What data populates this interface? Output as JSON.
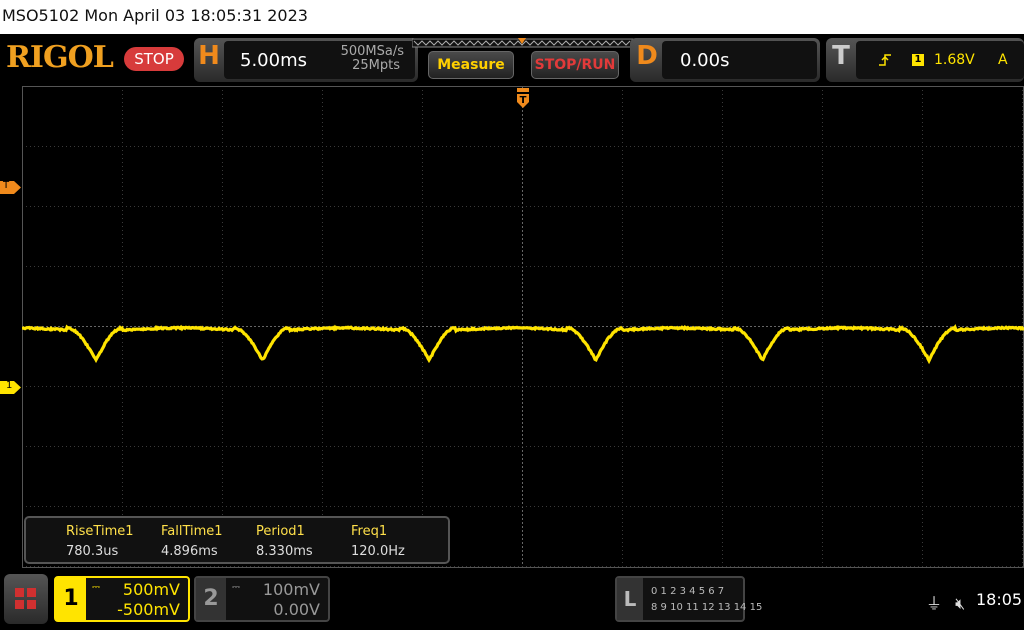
{
  "titlebar": {
    "text": "MSO5102  Mon April 03 18:05:31 2023"
  },
  "brand": {
    "logo": "RIGOL",
    "state": "STOP"
  },
  "horizontal": {
    "letter": "H",
    "timebase": "5.00ms",
    "sample_rate": "500MSa/s",
    "memory_depth": "25Mpts"
  },
  "buttons": {
    "measure": "Measure",
    "stop_run": "STOP/RUN"
  },
  "delay": {
    "letter": "D",
    "value": "0.00s"
  },
  "trigger": {
    "letter": "T",
    "channel": "1",
    "level": "1.68V",
    "mode": "A",
    "icon": "rising-edge-icon"
  },
  "markers": {
    "trigger_level": "T",
    "channel1": "1",
    "trigger_position": "T"
  },
  "measurements": [
    {
      "name": "RiseTime1",
      "value": "780.3us"
    },
    {
      "name": "FallTime1",
      "value": "4.896ms"
    },
    {
      "name": "Period1",
      "value": "8.330ms"
    },
    {
      "name": "Freq1",
      "value": "120.0Hz"
    }
  ],
  "channels": [
    {
      "number": "1",
      "scale": "500mV",
      "offset": "-500mV",
      "color": "#ffe400"
    },
    {
      "number": "2",
      "scale": "100mV",
      "offset": "0.00V",
      "color": "#999999"
    }
  ],
  "logic": {
    "letter": "L",
    "row1": "0 1 2 3   4 5 6 7",
    "row2": "8 9 10 11  12 13 14 15"
  },
  "status": {
    "usb_icon": "usb-icon",
    "sound_icon": "mute-icon",
    "time": "18:05"
  },
  "waveform": {
    "color": "#ffe400",
    "period_ms": 8.33,
    "timebase_ms_per_div": 5,
    "divisions": 10
  }
}
